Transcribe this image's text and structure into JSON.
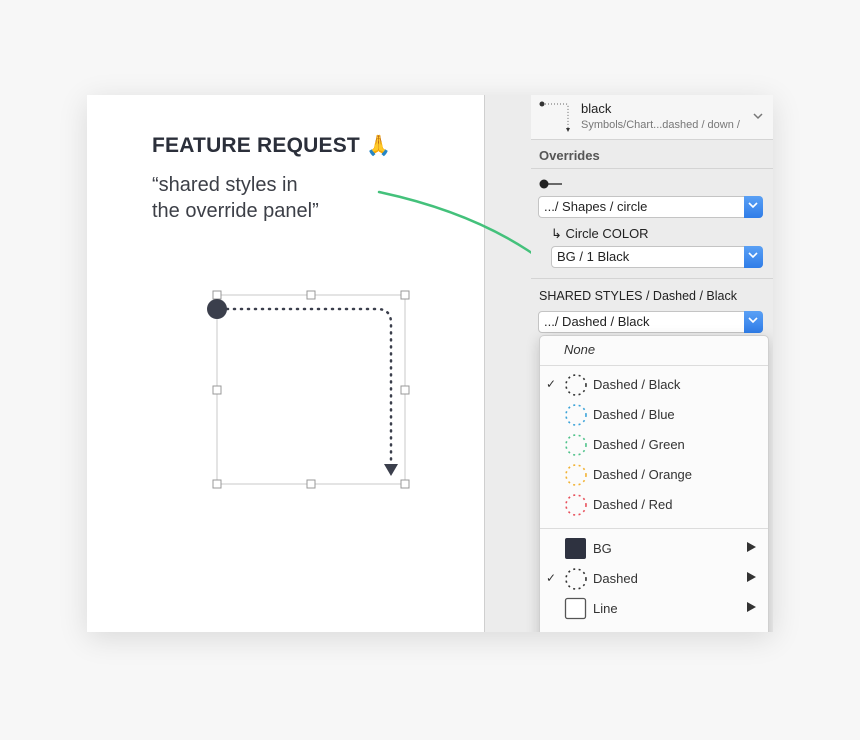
{
  "canvas": {
    "title": "FEATURE REQUEST",
    "emoji": "🙏",
    "quote": "“shared styles in\nthe override panel”"
  },
  "panel": {
    "symbol": {
      "name": "black",
      "path": "Symbols/Chart...dashed / down /"
    },
    "overrides_title": "Overrides",
    "shapes_select": {
      "value": ".../ Shapes / circle"
    },
    "circle_color_label": "↳ Circle COLOR",
    "bg_select": {
      "value": "BG / 1 Black"
    },
    "shared_styles_label": "SHARED STYLES / Dashed / Black",
    "dashed_select": {
      "value": ".../ Dashed / Black"
    }
  },
  "menu": {
    "none_label": "None",
    "styles": [
      {
        "label": "Dashed / Black",
        "color": "#333333",
        "checked": true
      },
      {
        "label": "Dashed / Blue",
        "color": "#3ba3d9",
        "checked": false
      },
      {
        "label": "Dashed / Green",
        "color": "#4ec28a",
        "checked": false
      },
      {
        "label": "Dashed / Orange",
        "color": "#f2b233",
        "checked": false
      },
      {
        "label": "Dashed / Red",
        "color": "#e8505b",
        "checked": false
      }
    ],
    "groups": [
      {
        "label": "BG",
        "checked": false
      },
      {
        "label": "Dashed",
        "checked": true
      },
      {
        "label": "Line",
        "checked": false
      }
    ],
    "check_glyph": "✓"
  },
  "colors": {
    "accent": "#2f7de8",
    "arrow": "#44c17b",
    "shape": "#3b3f4c"
  }
}
